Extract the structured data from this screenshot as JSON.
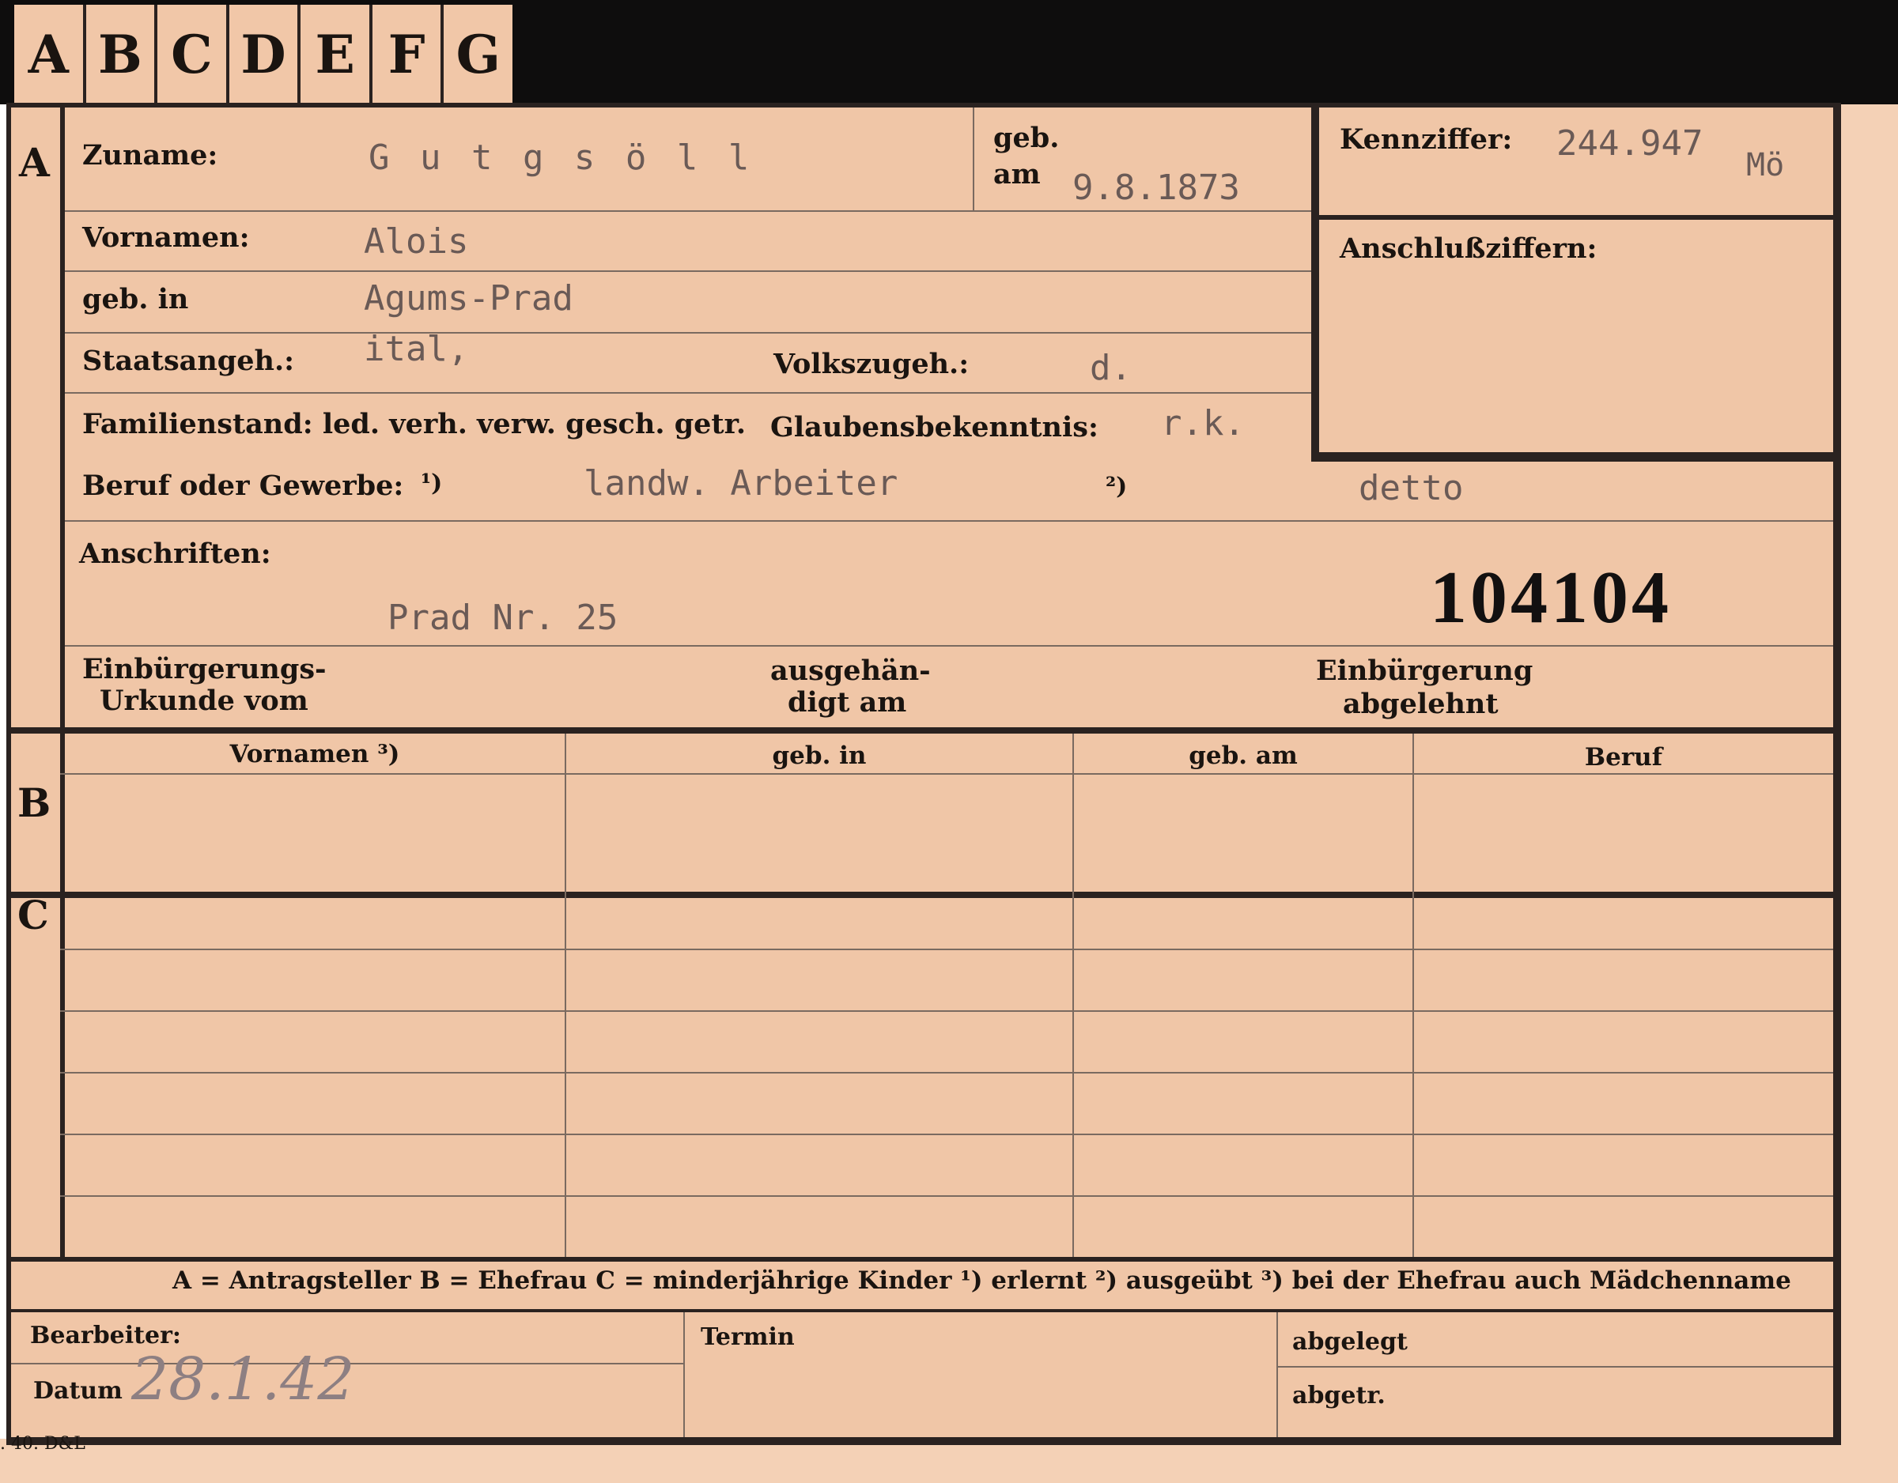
{
  "tabs": [
    "A",
    "B",
    "C",
    "D",
    "E",
    "F",
    "G"
  ],
  "sections": {
    "a": "A",
    "b": "B",
    "c": "C"
  },
  "fields": {
    "zuname_label": "Zuname:",
    "zuname_value": "G u t g s ö l l",
    "geb_label": "geb.",
    "am_label": "am",
    "geb_am_value": "9.8.1873",
    "kennziffer_label": "Kennziffer:",
    "kennziffer_value": "244.947",
    "kennziffer_suffix": "Mö",
    "anschluss_label": "Anschlußziffern:",
    "vornamen_label": "Vornamen:",
    "vornamen_value": "Alois",
    "geb_in_label": "geb. in",
    "geb_in_value": "Agums-Prad",
    "staat_label": "Staatsangeh.:",
    "staat_value": "ital,",
    "volk_label": "Volkszugeh.:",
    "volk_value": "d.",
    "familienstand_label": "Familienstand: led. verh. verw. gesch. getr.",
    "glauben_label": "Glaubensbekenntnis:",
    "glauben_value": "r.k.",
    "beruf_label": "Beruf oder Gewerbe:",
    "beruf_note1": "¹)",
    "beruf_value1": "landw. Arbeiter",
    "beruf_note2": "²)",
    "beruf_value2": "detto",
    "anschriften_label": "Anschriften:",
    "anschriften_value": "Prad Nr. 25",
    "number_stamp": "104104",
    "einb_urkunde_line1": "Einbürgerungs-",
    "einb_urkunde_line2": "Urkunde vom",
    "ausgeh_line1": "ausgehän-",
    "ausgeh_line2": "digt am",
    "einb_abgelehnt_line1": "Einbürgerung",
    "einb_abgelehnt_line2": "abgelehnt"
  },
  "table": {
    "headers": [
      "Vornamen ³)",
      "geb. in",
      "geb. am",
      "Beruf"
    ]
  },
  "legend": "A = Antragsteller   B = Ehefrau   C = minderjährige Kinder   ¹) erlernt   ²) ausgeübt   ³) bei der Ehefrau auch Mädchenname",
  "bottom": {
    "bearbeiter_label": "Bearbeiter:",
    "datum_label": "Datum",
    "datum_value": "28.1.42",
    "termin_label": "Termin",
    "abgelegt_label": "abgelegt",
    "abgetr_label": "abgetr."
  },
  "footer_code": ". 40. D&L"
}
